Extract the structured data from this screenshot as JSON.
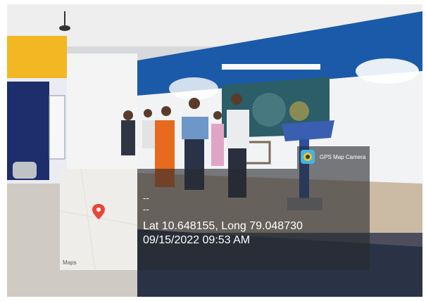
{
  "photo": {
    "description_icon": "event-stage-photo"
  },
  "overlay": {
    "app_name": "GPS Map Camera",
    "line1": "--",
    "line2": "--",
    "coordinates": "Lat 10.648155, Long 79.048730",
    "datetime": "09/15/2022 09:53 AM",
    "map_brand": "Maps",
    "pin_color": "#e8463a"
  }
}
